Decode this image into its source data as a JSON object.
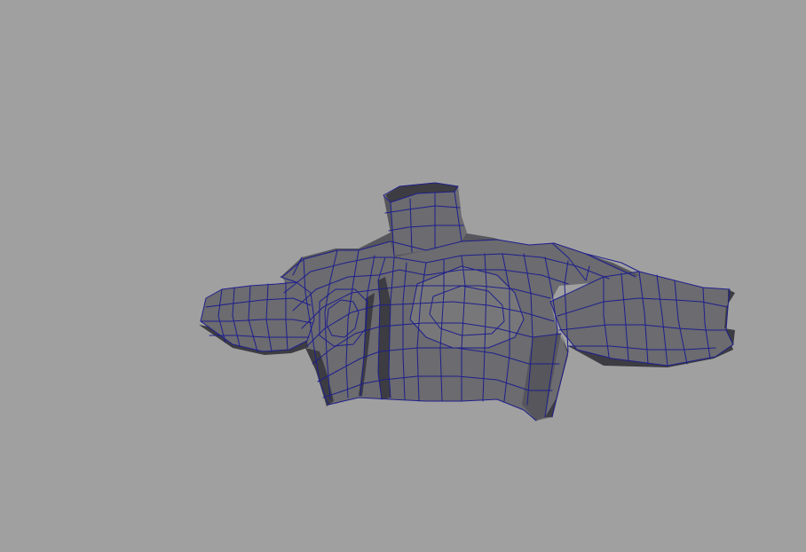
{
  "viewport": {
    "background_color": "#a0a0a0",
    "object": {
      "kind": "torso-mesh",
      "shading": "smooth-shaded-with-wireframe",
      "surface_color": "#6b6b70",
      "wireframe_color": "#1f1f8c"
    }
  }
}
